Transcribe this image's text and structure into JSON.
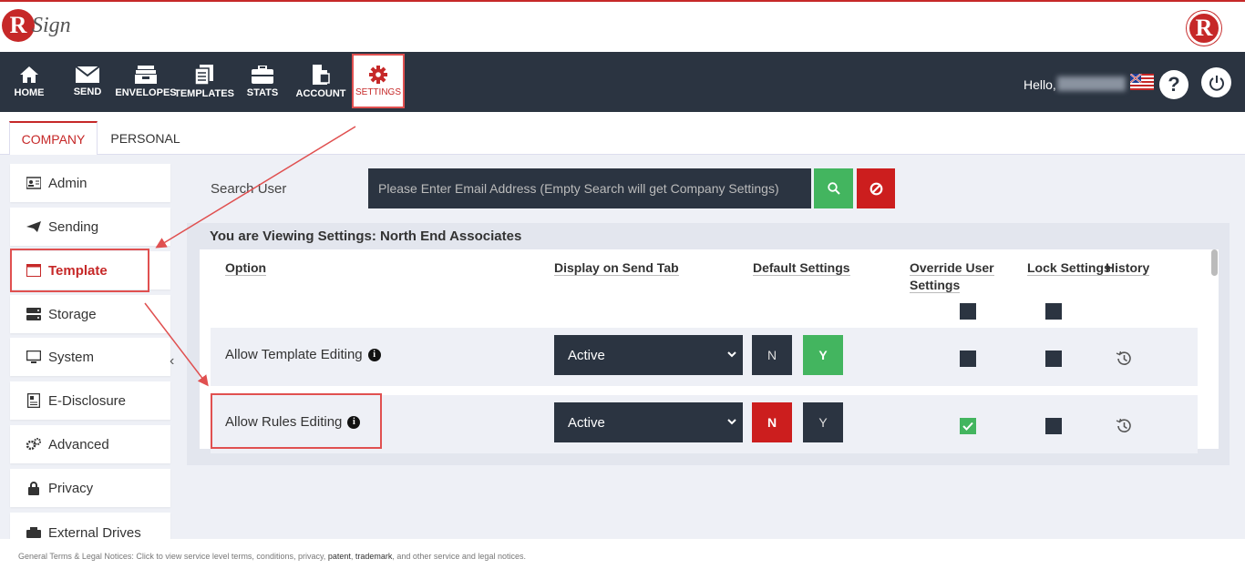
{
  "app": {
    "logo_letter": "R",
    "logo_text": "Sign"
  },
  "nav": {
    "items": [
      {
        "label": "HOME",
        "icon": "home-icon"
      },
      {
        "label": "SEND",
        "icon": "envelope-icon"
      },
      {
        "label": "ENVELOPES",
        "icon": "inbox-icon"
      },
      {
        "label": "TEMPLATES",
        "icon": "documents-icon"
      },
      {
        "label": "STATS",
        "icon": "briefcase-icon"
      },
      {
        "label": "ACCOUNT",
        "icon": "account-icon"
      },
      {
        "label": "SETTINGS",
        "icon": "gear-icon"
      }
    ],
    "greeting": "Hello,"
  },
  "tabs": [
    {
      "label": "COMPANY",
      "active": true
    },
    {
      "label": "PERSONAL",
      "active": false
    }
  ],
  "sidebar": {
    "items": [
      {
        "label": "Admin",
        "icon": "admin-icon"
      },
      {
        "label": "Sending",
        "icon": "paper-plane-icon"
      },
      {
        "label": "Template",
        "icon": "template-icon"
      },
      {
        "label": "Storage",
        "icon": "storage-icon"
      },
      {
        "label": "System",
        "icon": "monitor-icon"
      },
      {
        "label": "E-Disclosure",
        "icon": "disclosure-icon"
      },
      {
        "label": "Advanced",
        "icon": "gears-icon"
      },
      {
        "label": "Privacy",
        "icon": "lock-icon"
      },
      {
        "label": "External Drives Setup",
        "icon": "drive-icon"
      }
    ]
  },
  "search": {
    "label": "Search User",
    "placeholder": "Please Enter Email Address (Empty Search will get Company Settings)"
  },
  "settings": {
    "viewing_title": "You are Viewing Settings: North End Associates",
    "headers": {
      "option": "Option",
      "display": "Display on Send Tab",
      "default": "Default Settings",
      "override": "Override User Settings",
      "lock": "Lock Settings",
      "history": "History"
    },
    "rows": [
      {
        "label": "Allow Template Editing",
        "display": "Active",
        "n_label": "N",
        "y_label": "Y",
        "default": "Y",
        "override_checked": false,
        "lock_checked": false
      },
      {
        "label": "Allow Rules Editing",
        "display": "Active",
        "n_label": "N",
        "y_label": "Y",
        "default": "N",
        "override_checked": true,
        "lock_checked": false
      }
    ]
  },
  "footer": {
    "lead": "General Terms & Legal Notices:",
    "text": " Click to view service level terms, conditions, privacy, ",
    "link1": "patent",
    "sep": ", ",
    "link2": "trademark",
    "tail": ", and other service and legal notices."
  },
  "colors": {
    "brand": "#c62828",
    "dark": "#2b3441",
    "green": "#43b55f",
    "red": "#cc1e1e"
  }
}
